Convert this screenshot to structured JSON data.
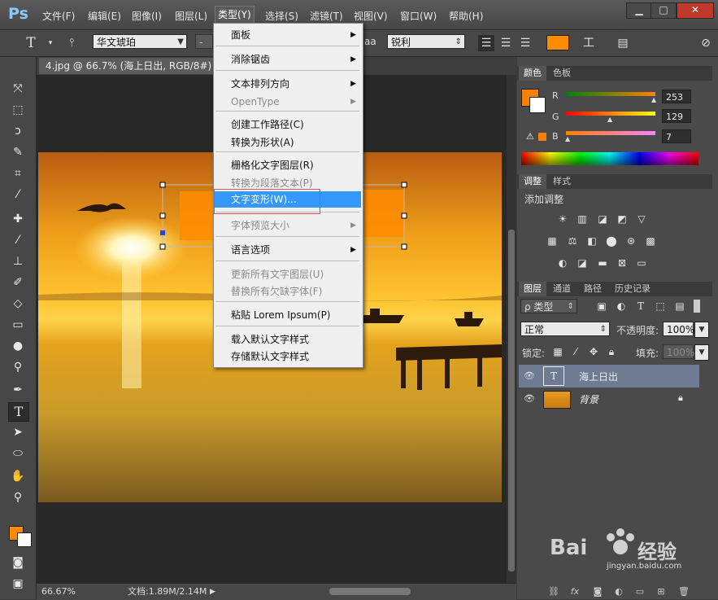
{
  "app": {
    "logo": "Ps"
  },
  "menubar": {
    "items": [
      "文件(F)",
      "编辑(E)",
      "图像(I)",
      "图层(L)",
      "类型(Y)",
      "选择(S)",
      "滤镜(T)",
      "视图(V)",
      "窗口(W)",
      "帮助(H)"
    ],
    "active": "类型(Y)"
  },
  "window_controls": {
    "minimize": "▁",
    "maximize": "□",
    "close": "✕"
  },
  "options_bar": {
    "font_family": "华文琥珀",
    "font_style": "-",
    "aa_label": "aa",
    "antialias": "锐利",
    "text_color": "#ff8c00"
  },
  "document": {
    "tab_title": "4.jpg @ 66.7% (海上日出, RGB/8#) *",
    "zoom": "66.67%",
    "doc_size": "文档:1.89M/2.14M"
  },
  "type_menu": {
    "items": [
      {
        "label": "面板",
        "submenu": true,
        "disabled": false
      },
      {
        "label": "消除锯齿",
        "submenu": true,
        "disabled": false
      },
      {
        "label": "文本排列方向",
        "submenu": true,
        "disabled": false
      },
      {
        "label": "OpenType",
        "submenu": true,
        "disabled": true
      },
      {
        "label": "创建工作路径(C)",
        "submenu": false,
        "disabled": false
      },
      {
        "label": "转换为形状(A)",
        "submenu": false,
        "disabled": false
      },
      {
        "label": "栅格化文字图层(R)",
        "submenu": false,
        "disabled": false
      },
      {
        "label": "转换为段落文本(P)",
        "submenu": false,
        "disabled": true
      },
      {
        "label": "文字变形(W)...",
        "submenu": false,
        "disabled": false,
        "highlighted": true
      },
      {
        "label": "字体预览大小",
        "submenu": true,
        "disabled": true
      },
      {
        "label": "语言选项",
        "submenu": true,
        "disabled": false
      },
      {
        "label": "更新所有文字图层(U)",
        "submenu": false,
        "disabled": true
      },
      {
        "label": "替换所有欠缺字体(F)",
        "submenu": false,
        "disabled": true
      },
      {
        "label": "粘贴 Lorem Ipsum(P)",
        "submenu": false,
        "disabled": false
      },
      {
        "label": "载入默认文字样式",
        "submenu": false,
        "disabled": false
      },
      {
        "label": "存储默认文字样式",
        "submenu": false,
        "disabled": false
      }
    ]
  },
  "color_panel": {
    "tabs": [
      "颜色",
      "色板"
    ],
    "r_label": "R",
    "g_label": "G",
    "b_label": "B",
    "r": "253",
    "g": "129",
    "b": "7",
    "foreground": "#fd8107",
    "background": "#ffffff",
    "r_level": 0.99,
    "g_level": 0.51,
    "b_level": 0.03
  },
  "adjust_panel": {
    "tabs": [
      "调整",
      "样式"
    ],
    "title": "添加调整"
  },
  "layers_panel": {
    "tabs": [
      "图层",
      "通道",
      "路径",
      "历史记录"
    ],
    "filter": "ρ 类型",
    "blend_mode": "正常",
    "opacity_label": "不透明度:",
    "opacity": "100%",
    "lock_label": "锁定:",
    "fill_label": "填充:",
    "fill": "100%",
    "layers": [
      {
        "name": "海上日出",
        "kind": "text",
        "thumb": "T",
        "selected": true
      },
      {
        "name": "背景",
        "kind": "image",
        "locked": true,
        "selected": false
      }
    ]
  },
  "watermark": {
    "brand": "Bai",
    "brand2": "经验",
    "url": "jingyan.baidu.com"
  },
  "colors": {
    "menu_highlight": "#3399ff",
    "accent_orange": "#ff8c00",
    "layer_selected": "#6e7b93"
  }
}
